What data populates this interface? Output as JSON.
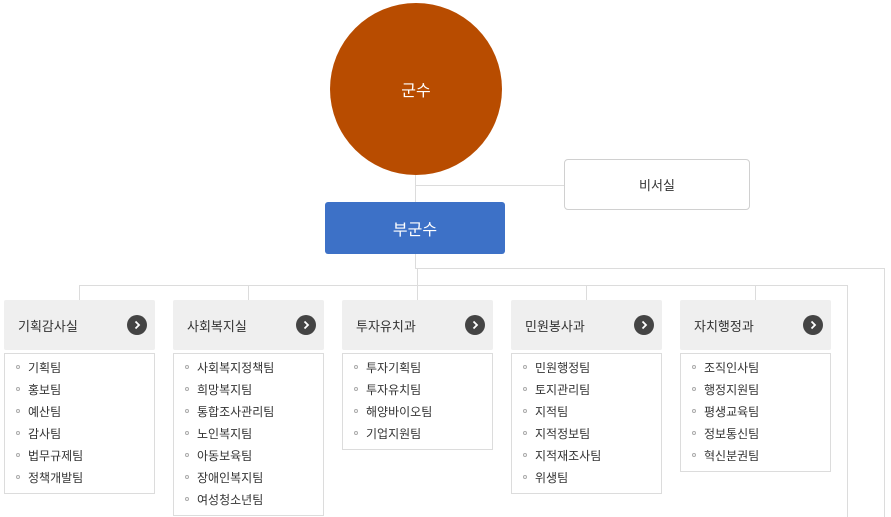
{
  "head": {
    "label": "군수"
  },
  "secretary": {
    "label": "비서실"
  },
  "deputy": {
    "label": "부군수"
  },
  "departments": [
    {
      "name": "기획감사실",
      "teams": [
        "기획팀",
        "홍보팀",
        "예산팀",
        "감사팀",
        "법무규제팀",
        "정책개발팀"
      ]
    },
    {
      "name": "사회복지실",
      "teams": [
        "사회복지정책팀",
        "희망복지팀",
        "통합조사관리팀",
        "노인복지팀",
        "아동보육팀",
        "장애인복지팀",
        "여성청소년팀"
      ]
    },
    {
      "name": "투자유치과",
      "teams": [
        "투자기획팀",
        "투자유치팀",
        "해양바이오팀",
        "기업지원팀"
      ]
    },
    {
      "name": "민원봉사과",
      "teams": [
        "민원행정팀",
        "토지관리팀",
        "지적팀",
        "지적정보팀",
        "지적재조사팀",
        "위생팀"
      ]
    },
    {
      "name": "자치행정과",
      "teams": [
        "조직인사팀",
        "행정지원팀",
        "평생교육팀",
        "정보통신팀",
        "혁신분권팀"
      ]
    }
  ],
  "colors": {
    "head": "#b84c00",
    "deputy": "#3d71c7",
    "connector": "#dcdcdc"
  }
}
